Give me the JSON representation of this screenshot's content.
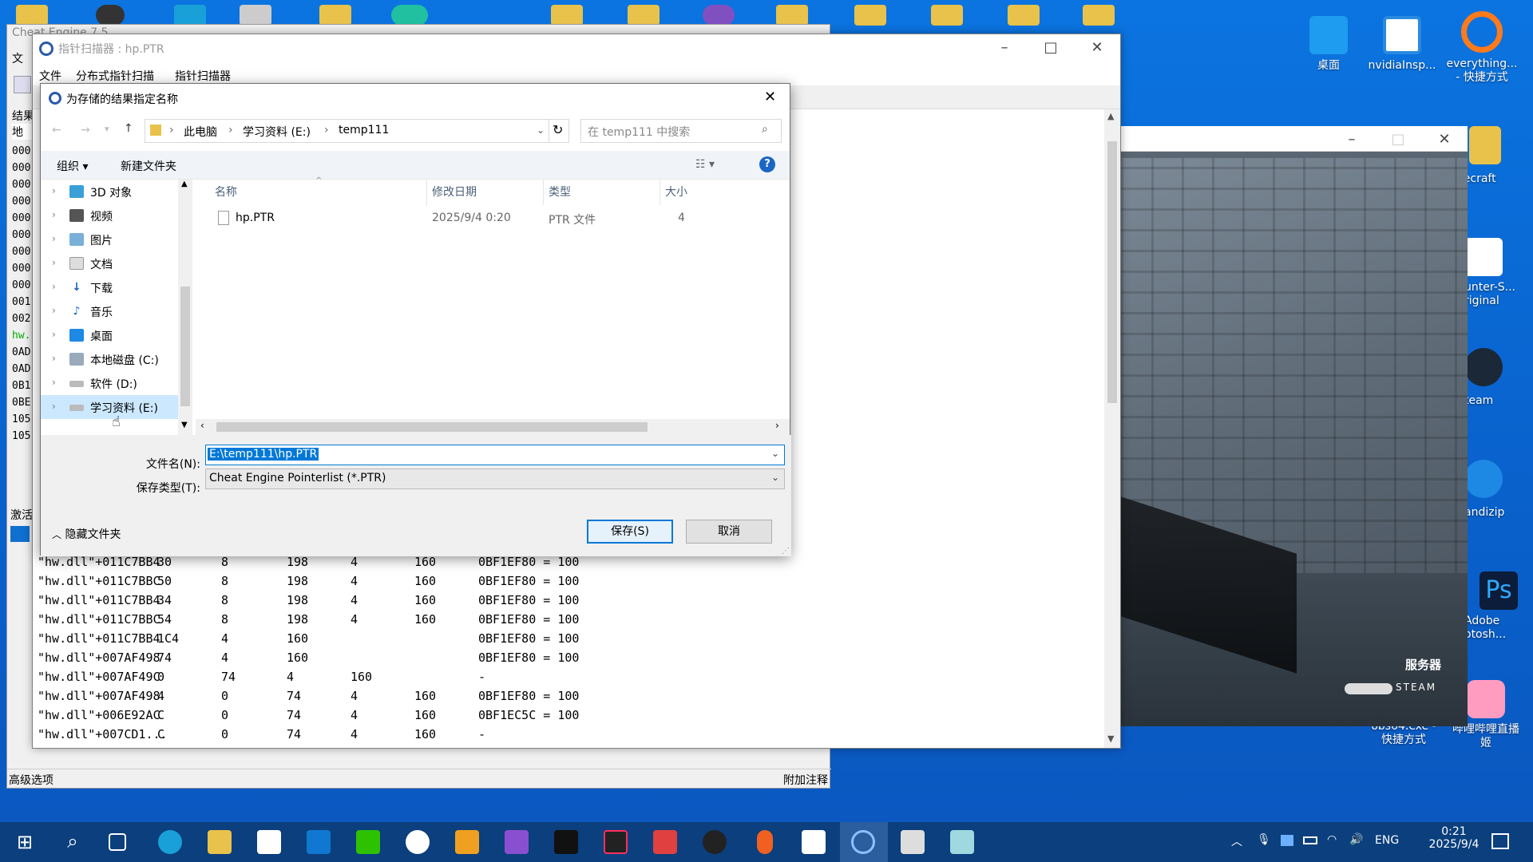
{
  "background_window": {
    "title": "Cheat Engine 7.5",
    "left_labels": [
      "文",
      "结果",
      "地"
    ],
    "left_col": [
      "000",
      "000",
      "000",
      "000",
      "000",
      "000",
      "000",
      "000",
      "000",
      "001",
      "002",
      "hw.",
      "0AD",
      "0AD",
      "0B1",
      "0BE",
      "105",
      "105"
    ],
    "footer_left": "高级选项",
    "footer_right": "附加注释",
    "activate_label": "激活"
  },
  "pointer_scanner": {
    "title": "指针扫描器 : hp.PTR",
    "menu": [
      "文件",
      "分布式指针扫描",
      "指针扫描器"
    ],
    "rows": [
      [
        "\"hw.dll\"+011C7BB4",
        "30",
        "8",
        "198",
        "4",
        "160",
        "0BF1EF80 = 100"
      ],
      [
        "\"hw.dll\"+011C7BBC",
        "50",
        "8",
        "198",
        "4",
        "160",
        "0BF1EF80 = 100"
      ],
      [
        "\"hw.dll\"+011C7BB4",
        "34",
        "8",
        "198",
        "4",
        "160",
        "0BF1EF80 = 100"
      ],
      [
        "\"hw.dll\"+011C7BBC",
        "54",
        "8",
        "198",
        "4",
        "160",
        "0BF1EF80 = 100"
      ],
      [
        "\"hw.dll\"+011C7BB4",
        "1C4",
        "4",
        "160",
        "",
        "",
        "0BF1EF80 = 100"
      ],
      [
        "\"hw.dll\"+007AF498",
        "74",
        "4",
        "160",
        "",
        "",
        "0BF1EF80 = 100"
      ],
      [
        "\"hw.dll\"+007AF49C",
        "0",
        "74",
        "4",
        "160",
        "",
        "-"
      ],
      [
        "\"hw.dll\"+007AF498",
        "4",
        "0",
        "74",
        "4",
        "160",
        "0BF1EF80 = 100"
      ],
      [
        "\"hw.dll\"+006E92AC",
        "C",
        "0",
        "74",
        "4",
        "160",
        "0BF1EC5C = 100"
      ],
      [
        "\"hw.dll\"+007CD1...",
        "C",
        "0",
        "74",
        "4",
        "160",
        "-"
      ]
    ]
  },
  "dialog": {
    "title": "为存储的结果指定名称",
    "breadcrumb": [
      "此电脑",
      "学习资料 (E:)",
      "temp111"
    ],
    "search_placeholder": "在 temp111 中搜索",
    "organize": "组织 ▾",
    "new_folder": "新建文件夹",
    "nav_items": [
      "3D 对象",
      "视频",
      "图片",
      "文档",
      "下载",
      "音乐",
      "桌面",
      "本地磁盘 (C:)",
      "软件 (D:)",
      "学习资料 (E:)"
    ],
    "nav_selected": 9,
    "columns": [
      "名称",
      "修改日期",
      "类型",
      "大小"
    ],
    "files": [
      {
        "name": "hp.PTR",
        "date": "2025/9/4 0:20",
        "type": "PTR 文件",
        "size": "4"
      }
    ],
    "filename_label": "文件名(N):",
    "filename_value": "E:\\temp111\\hp.PTR",
    "filetype_label": "保存类型(T):",
    "filetype_value": "Cheat Engine Pointerlist (*.PTR)",
    "hide_folders": "隐藏文件夹",
    "save_button": "保存(S)",
    "cancel_button": "取消"
  },
  "game": {
    "overlay_text": "服务器",
    "steam_text": "STEAM"
  },
  "desktop_icons": [
    {
      "label": "桌面"
    },
    {
      "label": "nvidiaInsp..."
    },
    {
      "label": "everything...\n- 快捷方式"
    },
    {
      "label": "inecraft"
    },
    {
      "label": "unter-S...\nriginal"
    },
    {
      "label": "team"
    },
    {
      "label": "andizip"
    },
    {
      "label": "Adobe\notosh..."
    },
    {
      "label": "obs64.exe -\n快捷方式"
    },
    {
      "label": "哔哩哔哩直播\n姬"
    }
  ],
  "taskbar": {
    "lang": "ENG",
    "time": "0:21",
    "date": "2025/9/4"
  },
  "colors": {
    "accent": "#0078d7",
    "selection": "#cce8ff",
    "desktop": "#0a6ad6"
  }
}
